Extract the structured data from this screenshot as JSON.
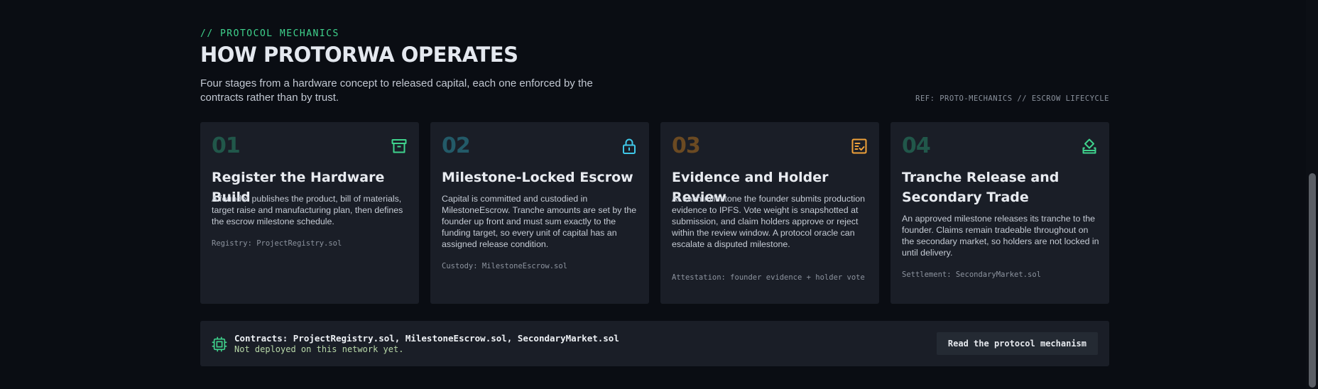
{
  "section": {
    "eyebrow": "// PROTOCOL MECHANICS",
    "title": "HOW PROTORWA OPERATES",
    "lede": "Four stages from a hardware concept to released capital, each one enforced by the contracts rather than by trust.",
    "ref": "REF: PROTO-MECHANICS // ESCROW LIFECYCLE"
  },
  "cards": [
    {
      "number": "01",
      "icon": "archive-icon",
      "title": "Register the Hardware Build",
      "body": "A founder publishes the product, bill of materials, target raise and manufacturing plan, then defines the escrow milestone schedule.",
      "meta": "Registry: ProjectRegistry.sol"
    },
    {
      "number": "02",
      "icon": "lock-icon",
      "title": "Milestone-Locked Escrow",
      "body": "Capital is committed and custodied in MilestoneEscrow. Tranche amounts are set by the founder up front and must sum exactly to the funding target, so every unit of capital has an assigned release condition.",
      "meta": "Custody: MilestoneEscrow.sol"
    },
    {
      "number": "03",
      "icon": "checklist-icon",
      "title": "Evidence and Holder Review",
      "body": "At each milestone the founder submits production evidence to IPFS. Vote weight is snapshotted at submission, and claim holders approve or reject within the review window. A protocol oracle can escalate a disputed milestone.",
      "meta": "Attestation: founder evidence + holder vote"
    },
    {
      "number": "04",
      "icon": "release-icon",
      "title": "Tranche Release and Secondary Trade",
      "body": "An approved milestone releases its tranche to the founder. Claims remain tradeable throughout on the secondary market, so holders are not locked in until delivery.",
      "meta": "Settlement: SecondaryMarket.sol"
    }
  ],
  "footer": {
    "icon": "chip-icon",
    "contracts": "Contracts: ProjectRegistry.sol, MilestoneEscrow.sol, SecondaryMarket.sol",
    "status": "Not deployed on this network yet.",
    "button": "Read the protocol mechanism"
  },
  "colors": {
    "accent_green": "#3fd38d",
    "accent_cyan": "#3fc8e8",
    "accent_orange": "#f0a23a",
    "card_bg": "#1a1e27",
    "page_bg": "#0a0d13"
  }
}
